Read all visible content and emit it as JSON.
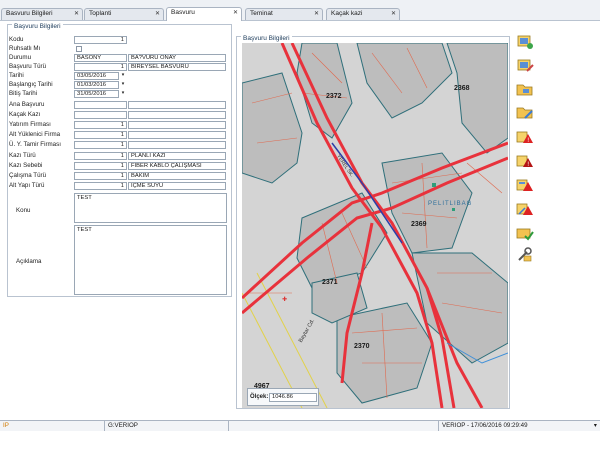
{
  "tabs": [
    {
      "label": "Basvuru Bilgileri"
    },
    {
      "label": "Toplanti"
    },
    {
      "label": "Basvuru"
    },
    {
      "label": "Teminat"
    },
    {
      "label": "Kaçak kazi"
    }
  ],
  "form": {
    "legend": "Başvuru Bilgileri",
    "kodu": {
      "label": "Kodu",
      "value": "1"
    },
    "ruhsatli": {
      "label": "Ruhsatlı Mı"
    },
    "durumu": {
      "label": "Durumu",
      "code": "BASONY",
      "text": "BA?VURU ONAY"
    },
    "basvuru_turu": {
      "label": "Başvuru Türü",
      "code": "1",
      "text": "BIREYSEL BASVURU"
    },
    "tarihi": {
      "label": "Tarihi",
      "value": "03/05/2016"
    },
    "baslangic": {
      "label": "Başlangıç Tarihi",
      "value": "01/03/2016"
    },
    "bitis": {
      "label": "Bitiş Tarihi",
      "value": "31/05/2016"
    },
    "ana_basvuru": {
      "label": "Ana Başvuru"
    },
    "kacak_kazi": {
      "label": "Kaçak Kazı"
    },
    "yatirim": {
      "label": "Yatırım Firması",
      "code": "1"
    },
    "alt_yuklenici": {
      "label": "Alt Yüklenici Firma",
      "code": "1"
    },
    "uy_tamir": {
      "label": "Ü. Y. Tamir Firması",
      "code": "1"
    },
    "kazi_turu": {
      "label": "Kazı Türü",
      "code": "1",
      "text": "PLANLI KAZI"
    },
    "kazi_sebebi": {
      "label": "Kazı Sebebi",
      "code": "1",
      "text": "FIBER KABLO ÇALIŞMASI"
    },
    "calisma_turu": {
      "label": "Çalışma Türü",
      "code": "1",
      "text": "BAKIM"
    },
    "alt_yapi": {
      "label": "Alt Yapı Türü",
      "code": "1",
      "text": "İÇME SUYU"
    },
    "konu": {
      "label": "Konu",
      "value": "TEST"
    },
    "aciklama": {
      "label": "Açıklama",
      "value": "TEST"
    }
  },
  "map": {
    "legend": "Başvuru Bilgileri",
    "parcels": [
      "2372",
      "2368",
      "2369",
      "2371",
      "2370",
      "4967"
    ],
    "district": "PELITLIBAG",
    "scale_label": "Ölçek:",
    "scale_value": "1046.86",
    "streets": [
      "Baytar Cd.",
      "YEREL SK."
    ]
  },
  "toolbar": {
    "icons": [
      "add-record-icon",
      "edit-record-icon",
      "folder-icon",
      "folder-edit-icon",
      "warning-icon",
      "warning-red-icon",
      "warning-yellow-icon",
      "warning-edit-icon",
      "approve-icon",
      "tools-icon"
    ]
  },
  "status": {
    "left": "IP",
    "db": "G:VERIOP",
    "user_time": "VERIOP - 17/06/2016 09:29:49"
  },
  "colors": {
    "road": "#e8323c",
    "parcel_line": "#e06a50",
    "building": "#bfbfbf",
    "outline": "#2f6f7a"
  }
}
